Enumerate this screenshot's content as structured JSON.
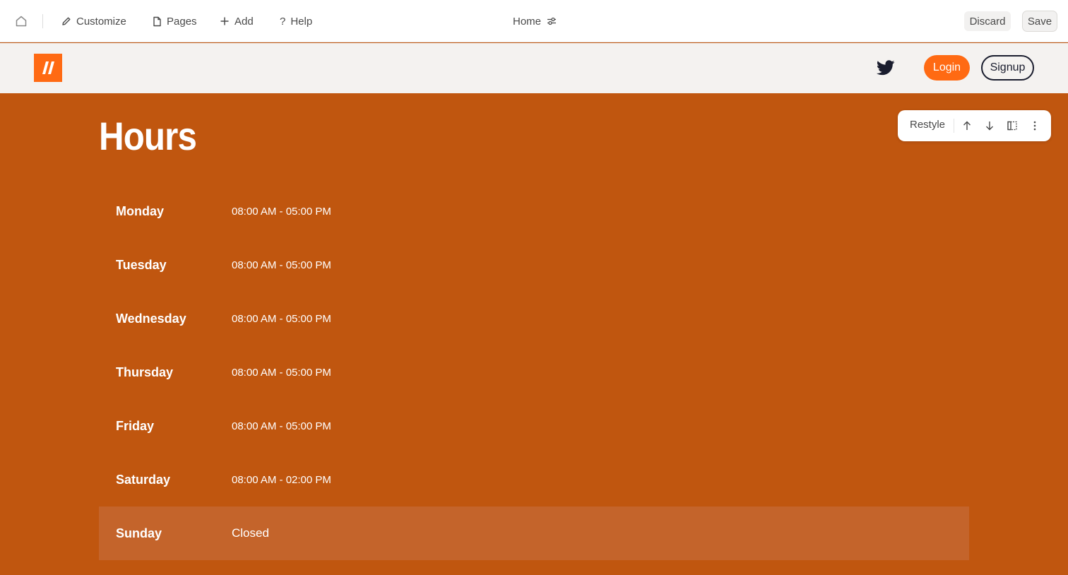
{
  "editor": {
    "customize_label": "Customize",
    "pages_label": "Pages",
    "add_label": "Add",
    "help_label": "Help",
    "page_name": "Home",
    "discard_label": "Discard",
    "save_label": "Save",
    "icons": [
      "home-icon",
      "pencil-icon",
      "page-icon",
      "plus-icon",
      "question-icon",
      "sliders-icon"
    ]
  },
  "site": {
    "login_label": "Login",
    "signup_label": "Signup",
    "icons": [
      "logo-icon",
      "twitter-icon"
    ]
  },
  "hours": {
    "title": "Hours",
    "rows": [
      {
        "day": "Monday",
        "time": "08:00 AM - 05:00 PM"
      },
      {
        "day": "Tuesday",
        "time": "08:00 AM - 05:00 PM"
      },
      {
        "day": "Wednesday",
        "time": "08:00 AM - 05:00 PM"
      },
      {
        "day": "Thursday",
        "time": "08:00 AM - 05:00 PM"
      },
      {
        "day": "Friday",
        "time": "08:00 AM - 05:00 PM"
      },
      {
        "day": "Saturday",
        "time": "08:00 AM - 02:00 PM"
      },
      {
        "day": "Sunday",
        "time": "Closed"
      }
    ]
  },
  "block_toolbar": {
    "restyle_label": "Restyle",
    "icons": [
      "arrow-up-icon",
      "arrow-down-icon",
      "layout-icon",
      "more-vertical-icon"
    ]
  },
  "colors": {
    "section_bg": "#c0560f",
    "highlight_row": "#c4642b",
    "brand_orange": "#ff6a13",
    "header_bg": "#f4f2f0",
    "dark": "#1a1d2e"
  }
}
